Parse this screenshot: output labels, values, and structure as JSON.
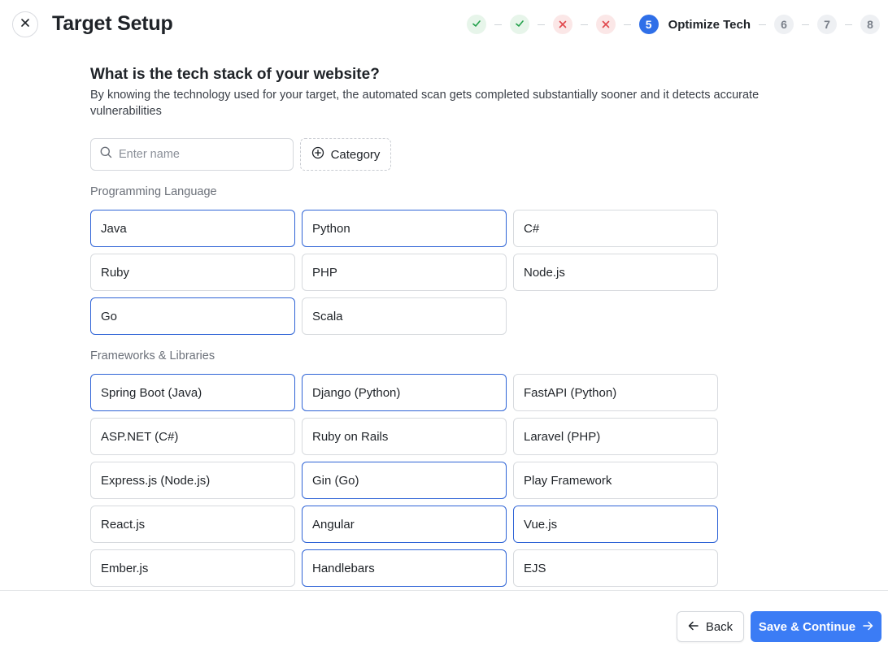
{
  "header": {
    "title": "Target Setup",
    "close_icon": "close-icon"
  },
  "stepper": {
    "steps": [
      {
        "number": "1",
        "status": "done",
        "icon": "check-icon",
        "color": "#22a04a"
      },
      {
        "number": "2",
        "status": "done",
        "icon": "check-icon",
        "color": "#22a04a"
      },
      {
        "number": "3",
        "status": "failed",
        "icon": "x-icon",
        "color": "#e0474c"
      },
      {
        "number": "4",
        "status": "failed",
        "icon": "x-icon",
        "color": "#e0474c"
      },
      {
        "number": "5",
        "status": "current",
        "label": "Optimize Tech",
        "color": "#2f6fe8"
      },
      {
        "number": "6",
        "status": "pending"
      },
      {
        "number": "7",
        "status": "pending"
      },
      {
        "number": "8",
        "status": "pending"
      }
    ]
  },
  "main": {
    "question": "What is the tech stack of your website?",
    "description": "By knowing the technology used for your target, the automated scan gets completed substantially sooner and it detects accurate vulnerabilities",
    "search": {
      "placeholder": "Enter name",
      "value": "",
      "icon": "search-icon"
    },
    "category_button": {
      "label": "Category",
      "icon": "plus-circle-icon"
    },
    "sections": [
      {
        "heading": "Programming Language",
        "items": [
          {
            "label": "Java",
            "selected": true
          },
          {
            "label": "Python",
            "selected": true
          },
          {
            "label": "C#",
            "selected": false
          },
          {
            "label": "Ruby",
            "selected": false
          },
          {
            "label": "PHP",
            "selected": false
          },
          {
            "label": "Node.js",
            "selected": false
          },
          {
            "label": "Go",
            "selected": true
          },
          {
            "label": "Scala",
            "selected": false
          }
        ]
      },
      {
        "heading": "Frameworks & Libraries",
        "items": [
          {
            "label": "Spring Boot (Java)",
            "selected": true
          },
          {
            "label": "Django (Python)",
            "selected": true
          },
          {
            "label": "FastAPI (Python)",
            "selected": false
          },
          {
            "label": "ASP.NET (C#)",
            "selected": false
          },
          {
            "label": "Ruby on Rails",
            "selected": false
          },
          {
            "label": "Laravel (PHP)",
            "selected": false
          },
          {
            "label": "Express.js (Node.js)",
            "selected": false
          },
          {
            "label": "Gin (Go)",
            "selected": true
          },
          {
            "label": "Play Framework",
            "selected": false
          },
          {
            "label": "React.js",
            "selected": false
          },
          {
            "label": "Angular",
            "selected": true
          },
          {
            "label": "Vue.js",
            "selected": true
          },
          {
            "label": "Ember.js",
            "selected": false
          },
          {
            "label": "Handlebars",
            "selected": true
          },
          {
            "label": "EJS",
            "selected": false
          }
        ]
      }
    ]
  },
  "footer": {
    "back_label": "Back",
    "back_icon": "arrow-left-icon",
    "save_label": "Save & Continue",
    "save_icon": "arrow-right-icon"
  },
  "colors": {
    "accent": "#3b7cf5",
    "selected_border": "#2f64d6",
    "success": "#22a04a",
    "error": "#e0474c"
  }
}
